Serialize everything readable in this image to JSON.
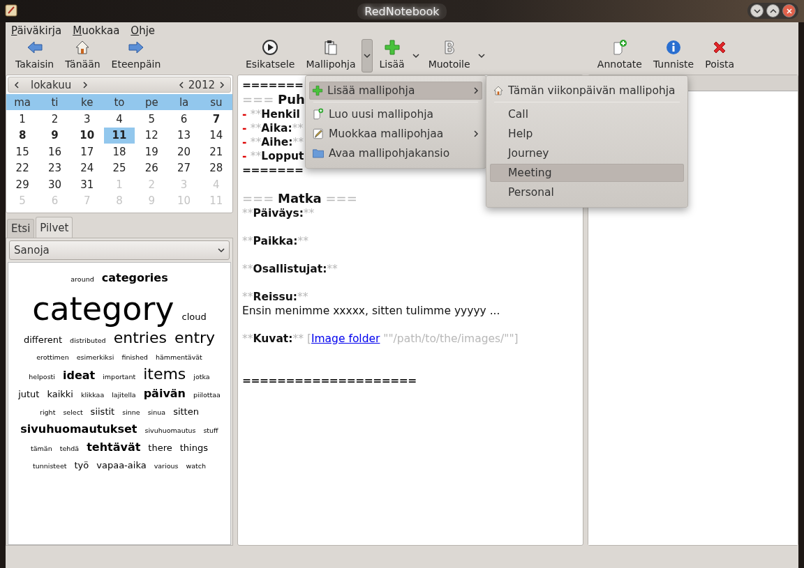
{
  "window": {
    "title": "RedNotebook"
  },
  "menubar": [
    {
      "mnemonic": "P",
      "rest": "äiväkirja"
    },
    {
      "mnemonic": "M",
      "rest": "uokkaa"
    },
    {
      "mnemonic": "O",
      "rest": "hje"
    }
  ],
  "toolbar": {
    "groups": [
      [
        {
          "kind": "back",
          "label": "Takaisin"
        },
        {
          "kind": "home",
          "label": "Tänään"
        },
        {
          "kind": "forward",
          "label": "Eteenpäin"
        }
      ],
      [
        {
          "kind": "play",
          "label": "Esikatsele"
        },
        {
          "kind": "clipboard",
          "label": "Mallipohja",
          "open": true
        },
        {
          "kind": "plus",
          "label": "Lisää",
          "open": false
        },
        {
          "kind": "bold",
          "label": "Muotoile",
          "open": false
        }
      ],
      [
        {
          "kind": "note",
          "label": "Annotate"
        },
        {
          "kind": "info",
          "label": "Tunniste"
        },
        {
          "kind": "delete",
          "label": "Poista"
        }
      ]
    ]
  },
  "calendar": {
    "month": "lokakuu",
    "year": "2012",
    "weekdays": [
      "ma",
      "ti",
      "ke",
      "to",
      "pe",
      "la",
      "su"
    ],
    "weeks": [
      [
        {
          "text": "1",
          "bold": false,
          "other": false,
          "selected": false
        },
        {
          "text": "2",
          "bold": false,
          "other": false,
          "selected": false
        },
        {
          "text": "3",
          "bold": false,
          "other": false,
          "selected": false
        },
        {
          "text": "4",
          "bold": false,
          "other": false,
          "selected": false
        },
        {
          "text": "5",
          "bold": false,
          "other": false,
          "selected": false
        },
        {
          "text": "6",
          "bold": false,
          "other": false,
          "selected": false
        },
        {
          "text": "7",
          "bold": true,
          "other": false,
          "selected": false
        }
      ],
      [
        {
          "text": "8",
          "bold": true,
          "other": false,
          "selected": false
        },
        {
          "text": "9",
          "bold": true,
          "other": false,
          "selected": false
        },
        {
          "text": "10",
          "bold": true,
          "other": false,
          "selected": false
        },
        {
          "text": "11",
          "bold": true,
          "other": false,
          "selected": true
        },
        {
          "text": "12",
          "bold": false,
          "other": false,
          "selected": false
        },
        {
          "text": "13",
          "bold": false,
          "other": false,
          "selected": false
        },
        {
          "text": "14",
          "bold": false,
          "other": false,
          "selected": false
        }
      ],
      [
        {
          "text": "15",
          "bold": false,
          "other": false,
          "selected": false
        },
        {
          "text": "16",
          "bold": false,
          "other": false,
          "selected": false
        },
        {
          "text": "17",
          "bold": false,
          "other": false,
          "selected": false
        },
        {
          "text": "18",
          "bold": false,
          "other": false,
          "selected": false
        },
        {
          "text": "19",
          "bold": false,
          "other": false,
          "selected": false
        },
        {
          "text": "20",
          "bold": false,
          "other": false,
          "selected": false
        },
        {
          "text": "21",
          "bold": false,
          "other": false,
          "selected": false
        }
      ],
      [
        {
          "text": "22",
          "bold": false,
          "other": false,
          "selected": false
        },
        {
          "text": "23",
          "bold": false,
          "other": false,
          "selected": false
        },
        {
          "text": "24",
          "bold": false,
          "other": false,
          "selected": false
        },
        {
          "text": "25",
          "bold": false,
          "other": false,
          "selected": false
        },
        {
          "text": "26",
          "bold": false,
          "other": false,
          "selected": false
        },
        {
          "text": "27",
          "bold": false,
          "other": false,
          "selected": false
        },
        {
          "text": "28",
          "bold": false,
          "other": false,
          "selected": false
        }
      ],
      [
        {
          "text": "29",
          "bold": false,
          "other": false,
          "selected": false
        },
        {
          "text": "30",
          "bold": false,
          "other": false,
          "selected": false
        },
        {
          "text": "31",
          "bold": false,
          "other": false,
          "selected": false
        },
        {
          "text": "1",
          "bold": false,
          "other": true,
          "selected": false
        },
        {
          "text": "2",
          "bold": false,
          "other": true,
          "selected": false
        },
        {
          "text": "3",
          "bold": false,
          "other": true,
          "selected": false
        },
        {
          "text": "4",
          "bold": false,
          "other": true,
          "selected": false
        }
      ],
      [
        {
          "text": "5",
          "bold": false,
          "other": true,
          "selected": false
        },
        {
          "text": "6",
          "bold": false,
          "other": true,
          "selected": false
        },
        {
          "text": "7",
          "bold": false,
          "other": true,
          "selected": false
        },
        {
          "text": "8",
          "bold": false,
          "other": true,
          "selected": false
        },
        {
          "text": "9",
          "bold": false,
          "other": true,
          "selected": false
        },
        {
          "text": "10",
          "bold": false,
          "other": true,
          "selected": false
        },
        {
          "text": "11",
          "bold": false,
          "other": true,
          "selected": false
        }
      ]
    ]
  },
  "tabs": [
    {
      "label": "Etsi",
      "selected": false
    },
    {
      "label": "Pilvet",
      "selected": true
    }
  ],
  "cloud_select": {
    "value": "Sanoja"
  },
  "cloud": [
    [
      {
        "text": "around",
        "kind": "tiny"
      },
      {
        "text": "categories",
        "kind": "medium"
      }
    ],
    [
      {
        "text": "category",
        "kind": "huge"
      },
      {
        "text": "cloud",
        "kind": "small"
      }
    ],
    [
      {
        "text": "different",
        "kind": "small"
      },
      {
        "text": "distributed",
        "kind": "tiny"
      },
      {
        "text": "entries",
        "kind": "large"
      },
      {
        "text": "entry",
        "kind": "large"
      }
    ],
    [
      {
        "text": "erottimen",
        "kind": "tiny"
      },
      {
        "text": "esimerkiksi",
        "kind": "tiny"
      },
      {
        "text": "finished",
        "kind": "tiny"
      },
      {
        "text": "hämmentävät",
        "kind": "tiny"
      }
    ],
    [
      {
        "text": "helposti",
        "kind": "tiny"
      },
      {
        "text": "ideat",
        "kind": "medium"
      },
      {
        "text": "important",
        "kind": "tiny"
      },
      {
        "text": "items",
        "kind": "large"
      },
      {
        "text": "jotka",
        "kind": "tiny"
      }
    ],
    [
      {
        "text": "jutut",
        "kind": "small"
      },
      {
        "text": "kaikki",
        "kind": "small"
      },
      {
        "text": "klikkaa",
        "kind": "tiny"
      },
      {
        "text": "lajitella",
        "kind": "tiny"
      },
      {
        "text": "päivän",
        "kind": "medium"
      },
      {
        "text": "piilottaa",
        "kind": "tiny"
      }
    ],
    [
      {
        "text": "right",
        "kind": "tiny"
      },
      {
        "text": "select",
        "kind": "tiny"
      },
      {
        "text": "siistit",
        "kind": "small"
      },
      {
        "text": "sinne",
        "kind": "tiny"
      },
      {
        "text": "sinua",
        "kind": "tiny"
      },
      {
        "text": "sitten",
        "kind": "small"
      }
    ],
    [
      {
        "text": "sivuhuomautukset",
        "kind": "medium"
      },
      {
        "text": "sivuhuomautus",
        "kind": "tiny"
      },
      {
        "text": "stuff",
        "kind": "tiny"
      }
    ],
    [
      {
        "text": "tämän",
        "kind": "tiny"
      },
      {
        "text": "tehdä",
        "kind": "tiny"
      },
      {
        "text": "tehtävät",
        "kind": "medium"
      },
      {
        "text": "there",
        "kind": "small"
      },
      {
        "text": "things",
        "kind": "small"
      }
    ],
    [
      {
        "text": "tunnisteet",
        "kind": "tiny"
      },
      {
        "text": "työ",
        "kind": "small"
      },
      {
        "text": "vapaa-aika",
        "kind": "small"
      },
      {
        "text": "various",
        "kind": "tiny"
      },
      {
        "text": "watch",
        "kind": "tiny"
      }
    ]
  ],
  "editor": {
    "lines": [
      {
        "kind": "rule",
        "text": "======="
      },
      {
        "kind": "heading",
        "open": "===",
        "text": "Puh"
      },
      {
        "kind": "bullet",
        "dash": "-",
        "open": "**",
        "text": "Henkil"
      },
      {
        "kind": "bullet",
        "dash": "-",
        "open": "**",
        "text": "Aika:",
        "close": "**"
      },
      {
        "kind": "bullet",
        "dash": "-",
        "open": "**",
        "text": "Aihe:",
        "close": "**"
      },
      {
        "kind": "bullet",
        "dash": "-",
        "open": "**",
        "text": "Lopput"
      },
      {
        "kind": "rule",
        "text": "======="
      },
      {
        "kind": "blank"
      },
      {
        "kind": "heading",
        "open": "===",
        "text": "Matka",
        "close": "==="
      },
      {
        "kind": "field",
        "open": "**",
        "text": "Päiväys:",
        "close": "**"
      },
      {
        "kind": "blank"
      },
      {
        "kind": "field",
        "open": "**",
        "text": "Paikka:",
        "close": "**"
      },
      {
        "kind": "blank"
      },
      {
        "kind": "field",
        "open": "**",
        "text": "Osallistujat:",
        "close": "**"
      },
      {
        "kind": "blank"
      },
      {
        "kind": "field",
        "open": "**",
        "text": "Reissu:",
        "close": "**"
      },
      {
        "kind": "text",
        "text": "Ensin menimme xxxxx, sitten tulimme yyyyy ..."
      },
      {
        "kind": "blank"
      },
      {
        "kind": "link",
        "open": "**",
        "text": "Kuvat:",
        "close": "**",
        "bracket": "[",
        "link": "Image folder",
        "path": "\"\"/path/to/the/images/\"\"",
        "end": "]"
      },
      {
        "kind": "blank"
      },
      {
        "kind": "blank"
      },
      {
        "kind": "rule",
        "text": "===================="
      }
    ]
  },
  "template_menu": [
    {
      "kind": "add",
      "label": "Lisää mallipohja",
      "submenu": true,
      "selected": true
    },
    {
      "kind": "new",
      "label": "Luo uusi mallipohja",
      "submenu": false,
      "selected": false
    },
    {
      "kind": "edit",
      "label": "Muokkaa mallipohjaa",
      "submenu": true,
      "selected": false
    },
    {
      "kind": "folder",
      "label": "Avaa mallipohjakansio",
      "submenu": false,
      "selected": false
    }
  ],
  "template_submenu": {
    "header": {
      "label": "Tämän viikonpäivän mallipohja"
    },
    "items": [
      {
        "label": "Call",
        "selected": false
      },
      {
        "label": "Help",
        "selected": false
      },
      {
        "label": "Journey",
        "selected": false
      },
      {
        "label": "Meeting",
        "selected": true
      },
      {
        "label": "Personal",
        "selected": false
      }
    ]
  }
}
